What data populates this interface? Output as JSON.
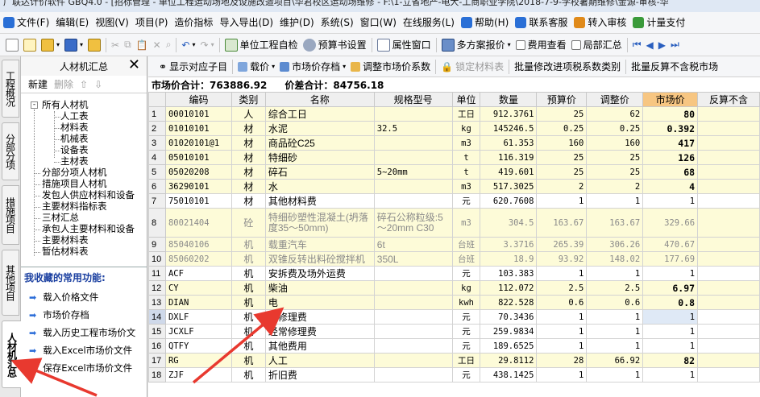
{
  "window": {
    "title": "广联达计价软件 GBQ4.0 - [招标管理 - 单位工程运动场地及设施改造项目\\华君校区运动场维修 - F:\\1-立省地产-电大-工商职业学院\\2018-7-9-学校暑期维修\\金源-审核-华"
  },
  "menu": {
    "items": [
      {
        "label": "文件(F)",
        "icon": "file-icon",
        "color": "#2a6fd6"
      },
      {
        "label": "编辑(E)"
      },
      {
        "label": "视图(V)"
      },
      {
        "label": "项目(P)"
      },
      {
        "label": "造价指标"
      },
      {
        "label": "导入导出(D)"
      },
      {
        "label": "维护(D)"
      },
      {
        "label": "系统(S)"
      },
      {
        "label": "窗口(W)"
      },
      {
        "label": "在线服务(L)"
      },
      {
        "label": "帮助(H)",
        "icon": "help-icon",
        "color": "#2a6fd6"
      },
      {
        "label": "联系客服",
        "icon": "customer-service-icon",
        "color": "#2a6fd6"
      },
      {
        "label": "转入审核",
        "icon": "review-icon",
        "color": "#e08a1a"
      },
      {
        "label": "计量支付",
        "icon": "payment-icon",
        "color": "#3a9a3a"
      }
    ]
  },
  "toolbar": {
    "project_check": "单位工程自检",
    "budget_settings": "预算书设置",
    "attribute_window": "属性窗口",
    "multi_plan_quote": "多方案报价",
    "fee_view": "费用查看",
    "partial_summary": "局部汇总"
  },
  "vtabs": [
    {
      "label": "工程概况"
    },
    {
      "label": "分部分项"
    },
    {
      "label": "措施项目"
    },
    {
      "label": "其他项目"
    },
    {
      "label": "人材机汇总"
    }
  ],
  "left_panel": {
    "title": "人材机汇总",
    "close": "✕",
    "new_label": "新建",
    "delete_label": "删除",
    "up_arrow": "⇧",
    "down_arrow": "⇩",
    "tree": {
      "root": "所有人材机",
      "children": [
        "人工表",
        "材料表",
        "机械表",
        "设备表",
        "主材表"
      ],
      "others": [
        "分部分项人材机",
        "措施项目人材机",
        "发包人供应材料和设备",
        "主要材料指标表",
        "三材汇总",
        "承包人主要材料和设备",
        "主要材料表",
        "暂估材料表"
      ]
    },
    "favorites_title": "我收藏的常用功能:",
    "favorites": [
      "载入价格文件",
      "市场价存档",
      "载入历史工程市场价文",
      "载入Excel市场价文件",
      "保存Excel市场价文件"
    ]
  },
  "subtoolbar": {
    "show_sub": "显示对应子目",
    "price": "载价",
    "market_save": "市场价存档",
    "adjust_coef": "调整市场价系数",
    "lock_table": "锁定材料表",
    "batch_tax": "批量修改进项税系数类别",
    "batch_reverse": "批量反算不含税市场"
  },
  "totals": {
    "market_label": "市场价合计：",
    "market_value": "763886.92",
    "diff_label": "价差合计：",
    "diff_value": "84756.18"
  },
  "table": {
    "headers": [
      "编码",
      "类别",
      "名称",
      "规格型号",
      "单位",
      "数量",
      "预算价",
      "调整价",
      "市场价",
      "反算不含"
    ],
    "rows": [
      {
        "n": "1",
        "code": "00010101",
        "cat": "人",
        "name": "综合工日",
        "spec": "",
        "unit": "工日",
        "qty": "912.3761",
        "budget": "25",
        "adj": "62",
        "market": "80",
        "style": "y",
        "bold": true
      },
      {
        "n": "2",
        "code": "01010101",
        "cat": "材",
        "name": "水泥",
        "spec": "32.5",
        "unit": "kg",
        "qty": "145246.5",
        "budget": "0.25",
        "adj": "0.25",
        "market": "0.392",
        "style": "y",
        "bold": true
      },
      {
        "n": "3",
        "code": "01020101@1",
        "cat": "材",
        "name": "商品砼C25",
        "spec": "",
        "unit": "m3",
        "qty": "61.353",
        "budget": "160",
        "adj": "160",
        "market": "417",
        "style": "y",
        "bold": true
      },
      {
        "n": "4",
        "code": "05010101",
        "cat": "材",
        "name": "特细砂",
        "spec": "",
        "unit": "t",
        "qty": "116.319",
        "budget": "25",
        "adj": "25",
        "market": "126",
        "style": "y",
        "bold": true
      },
      {
        "n": "5",
        "code": "05020208",
        "cat": "材",
        "name": "碎石",
        "spec": "5~20mm",
        "unit": "t",
        "qty": "419.601",
        "budget": "25",
        "adj": "25",
        "market": "68",
        "style": "y",
        "bold": true
      },
      {
        "n": "6",
        "code": "36290101",
        "cat": "材",
        "name": "水",
        "spec": "",
        "unit": "m3",
        "qty": "517.3025",
        "budget": "2",
        "adj": "2",
        "market": "4",
        "style": "y",
        "bold": true
      },
      {
        "n": "7",
        "code": "75010101",
        "cat": "材",
        "name": "其他材料费",
        "spec": "",
        "unit": "元",
        "qty": "620.7608",
        "budget": "1",
        "adj": "1",
        "market": "1",
        "style": "w",
        "bold": false
      },
      {
        "n": "8",
        "code": "80021404",
        "cat": "砼",
        "name": "特细砂塑性混凝土(坍落度35～50mm)",
        "spec": "碎石公称粒级:5～20mm C30",
        "unit": "m3",
        "qty": "304.5",
        "budget": "163.67",
        "adj": "163.67",
        "market": "329.66",
        "style": "g",
        "bold": false,
        "tall": true
      },
      {
        "n": "9",
        "code": "85040106",
        "cat": "机",
        "name": "载重汽车",
        "spec": "6t",
        "unit": "台班",
        "qty": "3.3716",
        "budget": "265.39",
        "adj": "306.26",
        "market": "470.67",
        "style": "g",
        "bold": false
      },
      {
        "n": "10",
        "code": "85060202",
        "cat": "机",
        "name": "双锥反转出料砼搅拌机",
        "spec": "350L",
        "unit": "台班",
        "qty": "18.9",
        "budget": "93.92",
        "adj": "148.02",
        "market": "177.69",
        "style": "g",
        "bold": false
      },
      {
        "n": "11",
        "code": "ACF",
        "cat": "机",
        "name": "安拆费及场外运费",
        "spec": "",
        "unit": "元",
        "qty": "103.383",
        "budget": "1",
        "adj": "1",
        "market": "1",
        "style": "w",
        "bold": false
      },
      {
        "n": "12",
        "code": "CY",
        "cat": "机",
        "name": "柴油",
        "spec": "",
        "unit": "kg",
        "qty": "112.072",
        "budget": "2.5",
        "adj": "2.5",
        "market": "6.97",
        "style": "y",
        "bold": true
      },
      {
        "n": "13",
        "code": "DIAN",
        "cat": "机",
        "name": "电",
        "spec": "",
        "unit": "kwh",
        "qty": "822.528",
        "budget": "0.6",
        "adj": "0.6",
        "market": "0.8",
        "style": "y",
        "bold": true
      },
      {
        "n": "14",
        "code": "DXLF",
        "cat": "机",
        "name": "大修理费",
        "spec": "",
        "unit": "元",
        "qty": "70.3436",
        "budget": "1",
        "adj": "1",
        "market": "1",
        "style": "w",
        "bold": false,
        "current": true
      },
      {
        "n": "15",
        "code": "JCXLF",
        "cat": "机",
        "name": "经常修理费",
        "spec": "",
        "unit": "元",
        "qty": "259.9834",
        "budget": "1",
        "adj": "1",
        "market": "1",
        "style": "w",
        "bold": false
      },
      {
        "n": "16",
        "code": "QTFY",
        "cat": "机",
        "name": "其他费用",
        "spec": "",
        "unit": "元",
        "qty": "189.6525",
        "budget": "1",
        "adj": "1",
        "market": "1",
        "style": "w",
        "bold": false
      },
      {
        "n": "17",
        "code": "RG",
        "cat": "机",
        "name": "人工",
        "spec": "",
        "unit": "工日",
        "qty": "29.8112",
        "budget": "28",
        "adj": "66.92",
        "market": "82",
        "style": "y",
        "bold": true
      },
      {
        "n": "18",
        "code": "ZJF",
        "cat": "机",
        "name": "折旧费",
        "spec": "",
        "unit": "元",
        "qty": "438.1425",
        "budget": "1",
        "adj": "1",
        "market": "1",
        "style": "w",
        "bold": false
      }
    ]
  },
  "colors": {
    "annotation_arrow": "#e8392f",
    "highlight_header": "#f7c682",
    "yellow_row": "#fdfbd8"
  }
}
